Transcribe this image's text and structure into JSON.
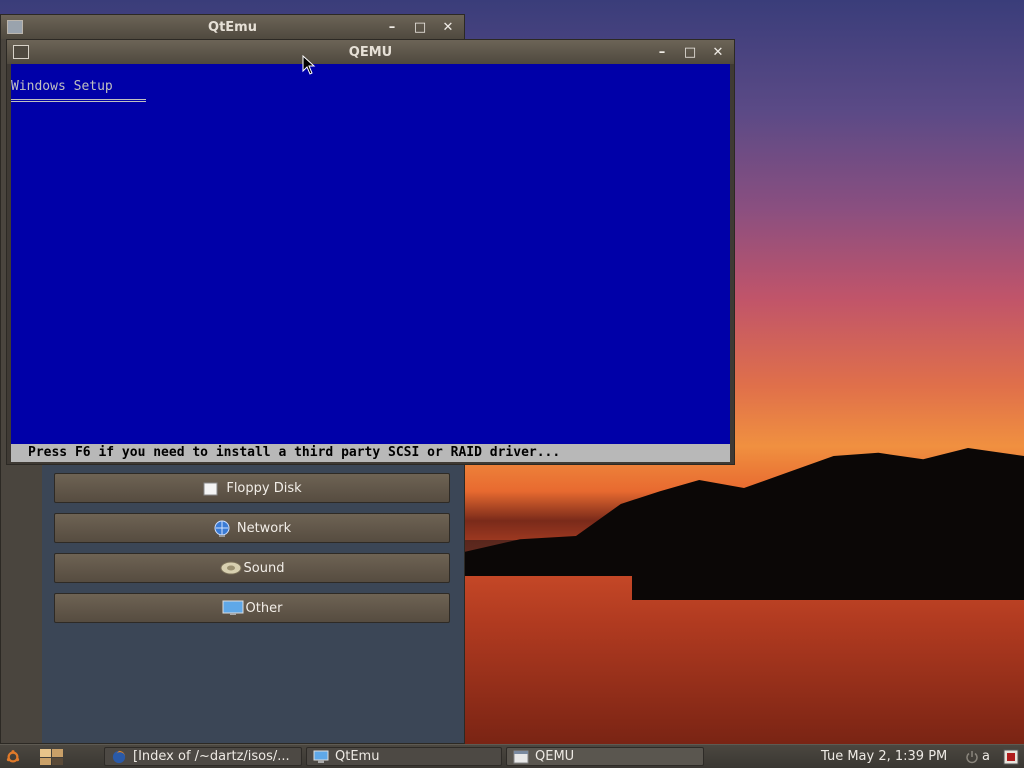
{
  "qtemu_window": {
    "title": "QtEmu",
    "devices": [
      {
        "label": "Floppy Disk",
        "icon": "floppy-icon"
      },
      {
        "label": "Network",
        "icon": "network-globe-icon"
      },
      {
        "label": "Sound",
        "icon": "sound-icon"
      },
      {
        "label": "Other",
        "icon": "monitor-icon"
      }
    ]
  },
  "qemu_window": {
    "title": "QEMU",
    "screen": {
      "heading": "Windows Setup",
      "status": "Press F6 if you need to install a third party SCSI or RAID driver...",
      "bg_color": "#0000a8",
      "text_color": "#c0c0c0"
    }
  },
  "window_buttons": {
    "minimize": "–",
    "maximize": "□",
    "close": "✕"
  },
  "taskbar": {
    "tasks": [
      {
        "label": "[Index of /~dartz/isos/...",
        "icon": "firefox-icon"
      },
      {
        "label": "QtEmu",
        "icon": "monitor-icon"
      },
      {
        "label": "QEMU",
        "icon": "window-icon"
      }
    ],
    "clock": "Tue May  2,  1:39 PM",
    "user": "a"
  }
}
